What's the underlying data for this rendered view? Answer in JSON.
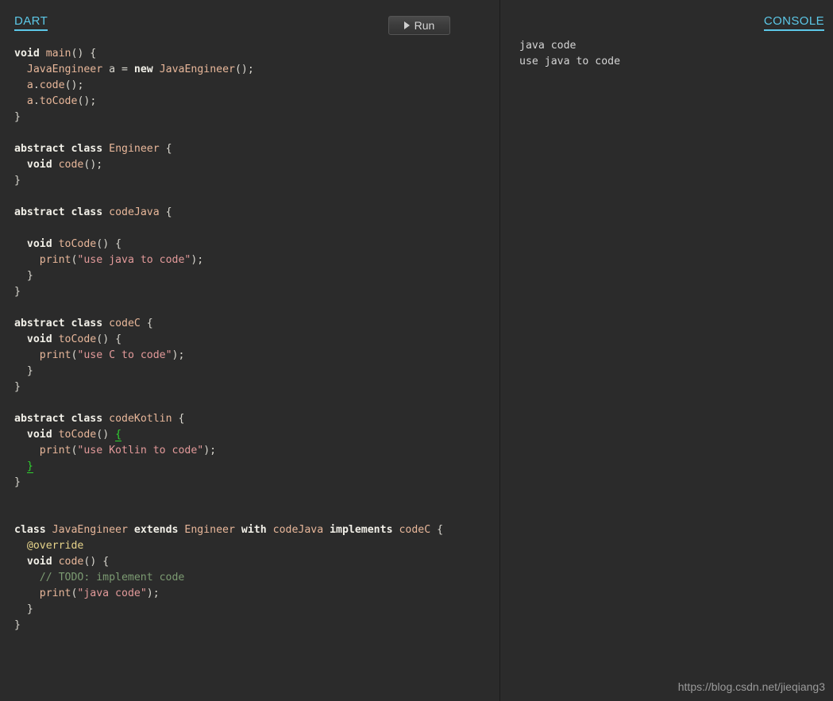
{
  "theme": {
    "background": "#2b2b2b",
    "accent": "#5cc8e8",
    "divider": "#1b1b1b",
    "keyword": "#f2f0e8",
    "identifier": "#e8b79a",
    "string": "#e39a9a",
    "comment": "#7c9b72",
    "annotation": "#e6d38a",
    "bracket_match": "#2fd22f",
    "default_text": "#d4d4d4",
    "watermark": "#9a9a9a"
  },
  "editor": {
    "tab_label": "DART",
    "run_button": {
      "label": "Run",
      "icon": "play-icon"
    },
    "language": "dart",
    "code_lines": [
      [
        {
          "t": "void",
          "c": "kw"
        },
        {
          "t": " ",
          "c": "punc"
        },
        {
          "t": "main",
          "c": "fn"
        },
        {
          "t": "() {",
          "c": "punc"
        }
      ],
      [
        {
          "t": "  ",
          "c": "punc"
        },
        {
          "t": "JavaEngineer",
          "c": "type"
        },
        {
          "t": " a ",
          "c": "punc"
        },
        {
          "t": "=",
          "c": "punc"
        },
        {
          "t": " ",
          "c": "punc"
        },
        {
          "t": "new",
          "c": "kw"
        },
        {
          "t": " ",
          "c": "punc"
        },
        {
          "t": "JavaEngineer",
          "c": "type"
        },
        {
          "t": "();",
          "c": "punc"
        }
      ],
      [
        {
          "t": "  ",
          "c": "punc"
        },
        {
          "t": "a",
          "c": "id"
        },
        {
          "t": ".",
          "c": "punc"
        },
        {
          "t": "code",
          "c": "id"
        },
        {
          "t": "();",
          "c": "punc"
        }
      ],
      [
        {
          "t": "  ",
          "c": "punc"
        },
        {
          "t": "a",
          "c": "id"
        },
        {
          "t": ".",
          "c": "punc"
        },
        {
          "t": "toCode",
          "c": "id"
        },
        {
          "t": "();",
          "c": "punc"
        }
      ],
      [
        {
          "t": "}",
          "c": "punc"
        }
      ],
      [],
      [
        {
          "t": "abstract",
          "c": "kw"
        },
        {
          "t": " ",
          "c": "punc"
        },
        {
          "t": "class",
          "c": "kw"
        },
        {
          "t": " ",
          "c": "punc"
        },
        {
          "t": "Engineer",
          "c": "type"
        },
        {
          "t": " {",
          "c": "punc"
        }
      ],
      [
        {
          "t": "  ",
          "c": "punc"
        },
        {
          "t": "void",
          "c": "kw"
        },
        {
          "t": " ",
          "c": "punc"
        },
        {
          "t": "code",
          "c": "fn"
        },
        {
          "t": "();",
          "c": "punc"
        }
      ],
      [
        {
          "t": "}",
          "c": "punc"
        }
      ],
      [],
      [
        {
          "t": "abstract",
          "c": "kw"
        },
        {
          "t": " ",
          "c": "punc"
        },
        {
          "t": "class",
          "c": "kw"
        },
        {
          "t": " ",
          "c": "punc"
        },
        {
          "t": "codeJava",
          "c": "type"
        },
        {
          "t": " {",
          "c": "punc"
        }
      ],
      [],
      [
        {
          "t": "  ",
          "c": "punc"
        },
        {
          "t": "void",
          "c": "kw"
        },
        {
          "t": " ",
          "c": "punc"
        },
        {
          "t": "toCode",
          "c": "fn"
        },
        {
          "t": "() {",
          "c": "punc"
        }
      ],
      [
        {
          "t": "    ",
          "c": "punc"
        },
        {
          "t": "print",
          "c": "fn"
        },
        {
          "t": "(",
          "c": "punc"
        },
        {
          "t": "\"use java to code\"",
          "c": "str"
        },
        {
          "t": ");",
          "c": "punc"
        }
      ],
      [
        {
          "t": "  }",
          "c": "punc"
        }
      ],
      [
        {
          "t": "}",
          "c": "punc"
        }
      ],
      [],
      [
        {
          "t": "abstract",
          "c": "kw"
        },
        {
          "t": " ",
          "c": "punc"
        },
        {
          "t": "class",
          "c": "kw"
        },
        {
          "t": " ",
          "c": "punc"
        },
        {
          "t": "codeC",
          "c": "type"
        },
        {
          "t": " {",
          "c": "punc"
        }
      ],
      [
        {
          "t": "  ",
          "c": "punc"
        },
        {
          "t": "void",
          "c": "kw"
        },
        {
          "t": " ",
          "c": "punc"
        },
        {
          "t": "toCode",
          "c": "fn"
        },
        {
          "t": "() {",
          "c": "punc"
        }
      ],
      [
        {
          "t": "    ",
          "c": "punc"
        },
        {
          "t": "print",
          "c": "fn"
        },
        {
          "t": "(",
          "c": "punc"
        },
        {
          "t": "\"use C to code\"",
          "c": "str"
        },
        {
          "t": ");",
          "c": "punc"
        }
      ],
      [
        {
          "t": "  }",
          "c": "punc"
        }
      ],
      [
        {
          "t": "}",
          "c": "punc"
        }
      ],
      [],
      [
        {
          "t": "abstract",
          "c": "kw"
        },
        {
          "t": " ",
          "c": "punc"
        },
        {
          "t": "class",
          "c": "kw"
        },
        {
          "t": " ",
          "c": "punc"
        },
        {
          "t": "codeKotlin",
          "c": "type"
        },
        {
          "t": " {",
          "c": "punc"
        }
      ],
      [
        {
          "t": "  ",
          "c": "punc"
        },
        {
          "t": "void",
          "c": "kw"
        },
        {
          "t": " ",
          "c": "punc"
        },
        {
          "t": "toCode",
          "c": "fn"
        },
        {
          "t": "() ",
          "c": "punc"
        },
        {
          "t": "{",
          "c": "match"
        }
      ],
      [
        {
          "t": "    ",
          "c": "punc"
        },
        {
          "t": "print",
          "c": "fn"
        },
        {
          "t": "(",
          "c": "punc"
        },
        {
          "t": "\"use Kotlin to code\"",
          "c": "str"
        },
        {
          "t": ");",
          "c": "punc"
        }
      ],
      [
        {
          "t": "  ",
          "c": "punc"
        },
        {
          "t": "}",
          "c": "match"
        }
      ],
      [
        {
          "t": "}",
          "c": "punc"
        }
      ],
      [],
      [],
      [
        {
          "t": "class",
          "c": "kw"
        },
        {
          "t": " ",
          "c": "punc"
        },
        {
          "t": "JavaEngineer",
          "c": "type"
        },
        {
          "t": " ",
          "c": "punc"
        },
        {
          "t": "extends",
          "c": "kw"
        },
        {
          "t": " ",
          "c": "punc"
        },
        {
          "t": "Engineer",
          "c": "type"
        },
        {
          "t": " ",
          "c": "punc"
        },
        {
          "t": "with",
          "c": "kw"
        },
        {
          "t": " ",
          "c": "punc"
        },
        {
          "t": "codeJava",
          "c": "type"
        },
        {
          "t": " ",
          "c": "punc"
        },
        {
          "t": "implements",
          "c": "kw"
        },
        {
          "t": " ",
          "c": "punc"
        },
        {
          "t": "codeC",
          "c": "type"
        },
        {
          "t": " {",
          "c": "punc"
        }
      ],
      [
        {
          "t": "  ",
          "c": "punc"
        },
        {
          "t": "@override",
          "c": "anno"
        }
      ],
      [
        {
          "t": "  ",
          "c": "punc"
        },
        {
          "t": "void",
          "c": "kw"
        },
        {
          "t": " ",
          "c": "punc"
        },
        {
          "t": "code",
          "c": "fn"
        },
        {
          "t": "() {",
          "c": "punc"
        }
      ],
      [
        {
          "t": "    ",
          "c": "punc"
        },
        {
          "t": "// TODO: implement code",
          "c": "cmt"
        }
      ],
      [
        {
          "t": "    ",
          "c": "punc"
        },
        {
          "t": "print",
          "c": "fn"
        },
        {
          "t": "(",
          "c": "punc"
        },
        {
          "t": "\"java code\"",
          "c": "str"
        },
        {
          "t": ");",
          "c": "punc"
        }
      ],
      [
        {
          "t": "  }",
          "c": "punc"
        }
      ],
      [
        {
          "t": "}",
          "c": "punc"
        }
      ]
    ]
  },
  "console": {
    "tab_label": "CONSOLE",
    "output_lines": [
      "java code",
      "use java to code"
    ]
  },
  "watermark": {
    "text": "https://blog.csdn.net/jieqiang3"
  }
}
